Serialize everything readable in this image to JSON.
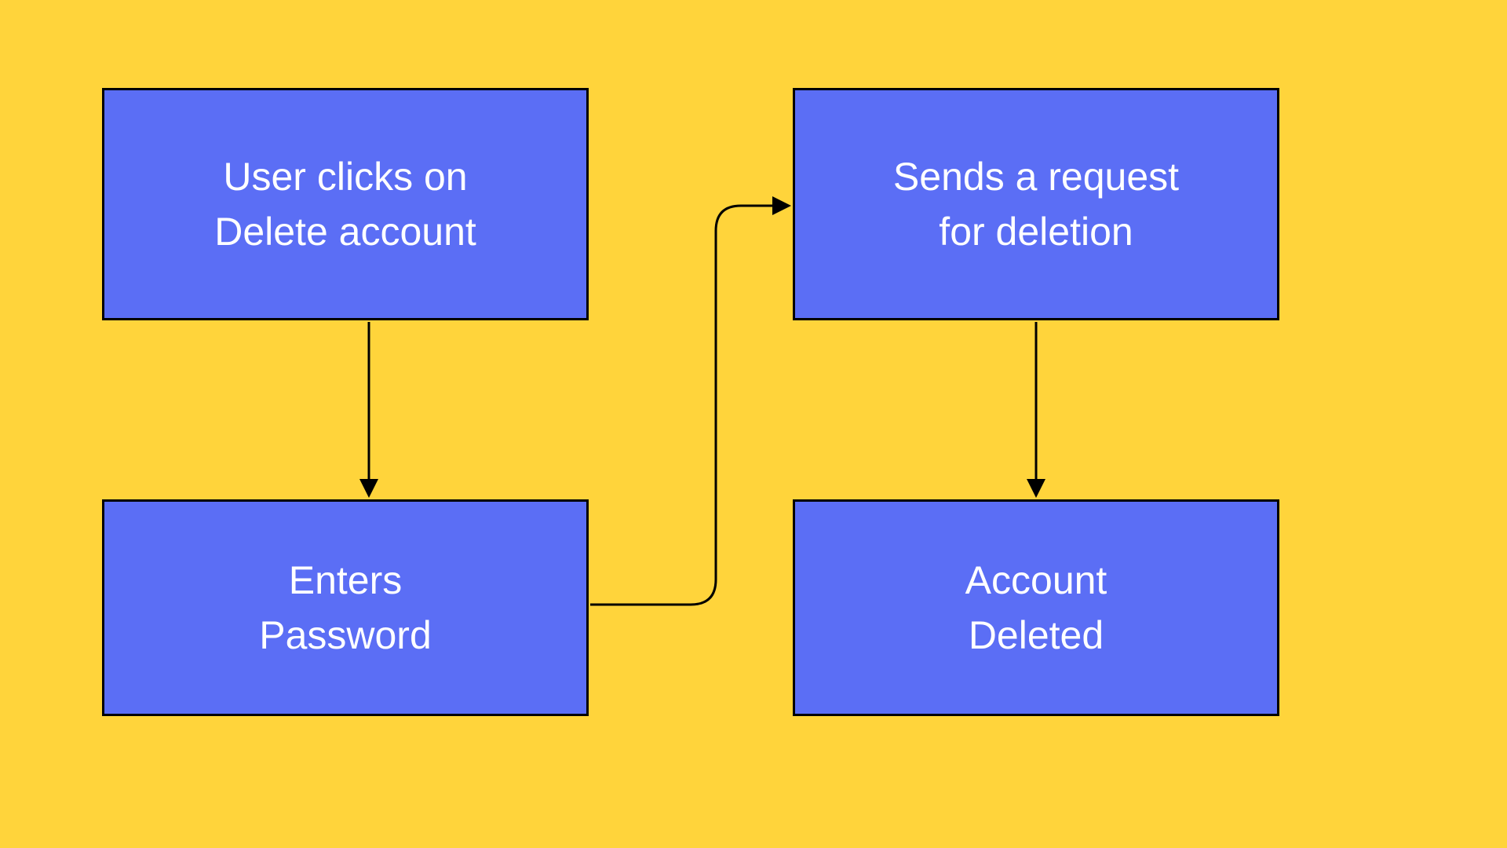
{
  "diagram": {
    "nodes": {
      "n1": {
        "label": "User clicks on\nDelete  account"
      },
      "n2": {
        "label": "Enters\nPassword"
      },
      "n3": {
        "label": "Sends a request\nfor deletion"
      },
      "n4": {
        "label": "Account\nDeleted"
      }
    },
    "edges": [
      {
        "from": "n1",
        "to": "n2"
      },
      {
        "from": "n2",
        "to": "n3"
      },
      {
        "from": "n3",
        "to": "n4"
      }
    ],
    "colors": {
      "background": "#ffd43b",
      "node_fill": "#5b6ef5",
      "node_border": "#000000",
      "arrow": "#000000",
      "text": "#ffffff"
    }
  }
}
